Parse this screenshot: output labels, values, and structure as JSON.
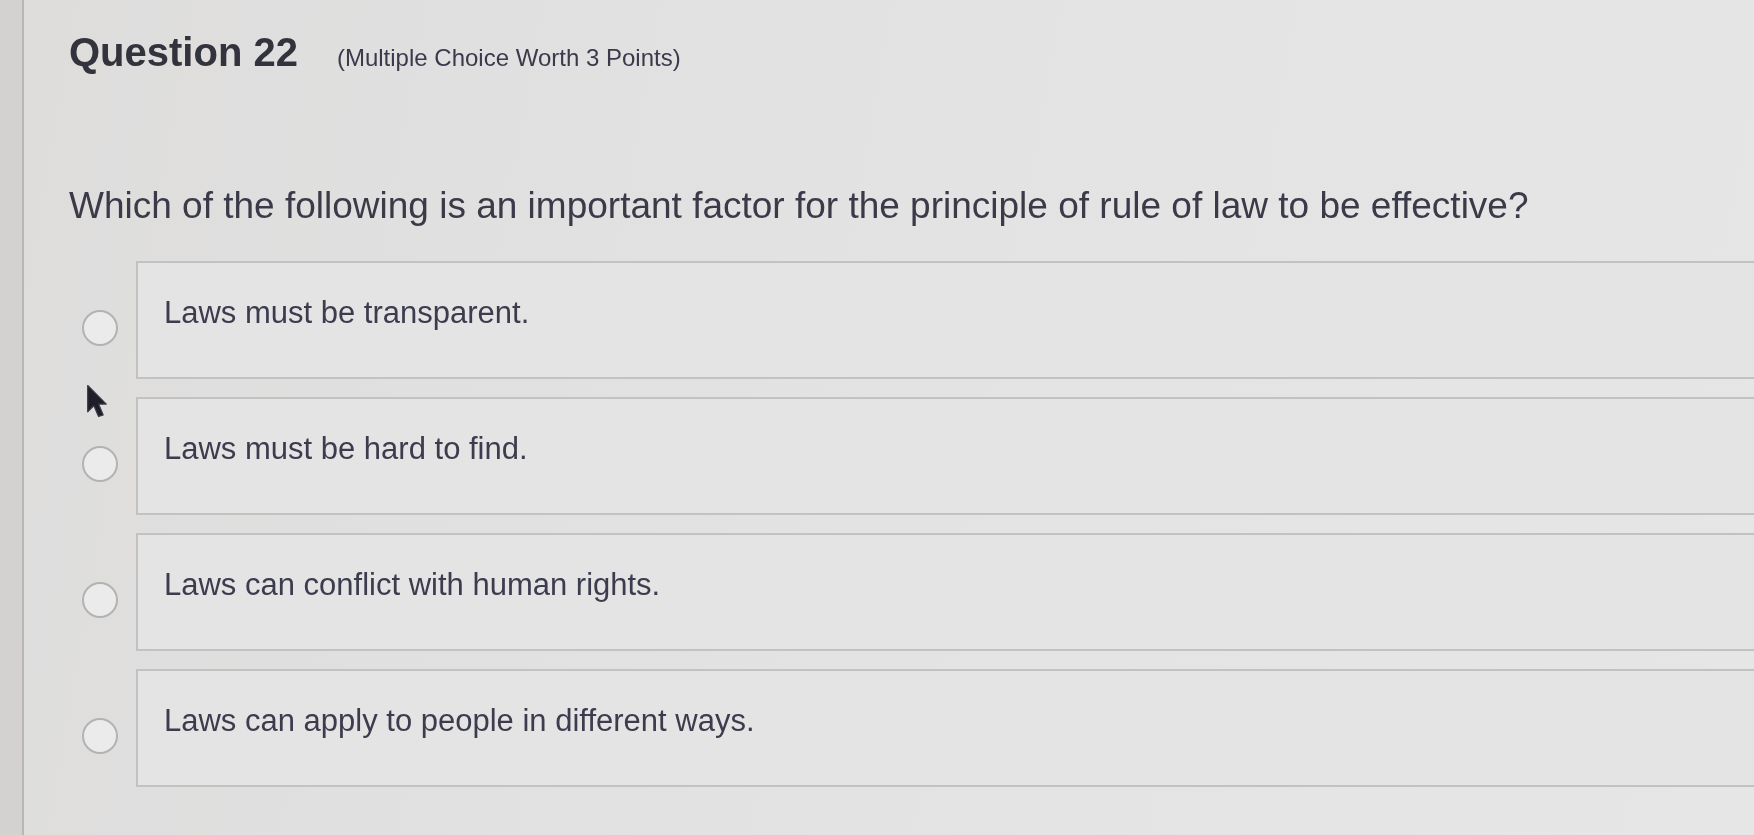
{
  "question": {
    "number_label": "Question 22",
    "meta": "(Multiple Choice Worth 3 Points)",
    "prompt": "Which of the following is an important factor for the principle of rule of law to be effective?"
  },
  "options": [
    {
      "text": "Laws must be transparent.",
      "selected": false
    },
    {
      "text": "Laws must be hard to find.",
      "selected": false
    },
    {
      "text": "Laws can conflict with human rights.",
      "selected": false
    },
    {
      "text": "Laws can apply to people in different ways.",
      "selected": false
    }
  ]
}
